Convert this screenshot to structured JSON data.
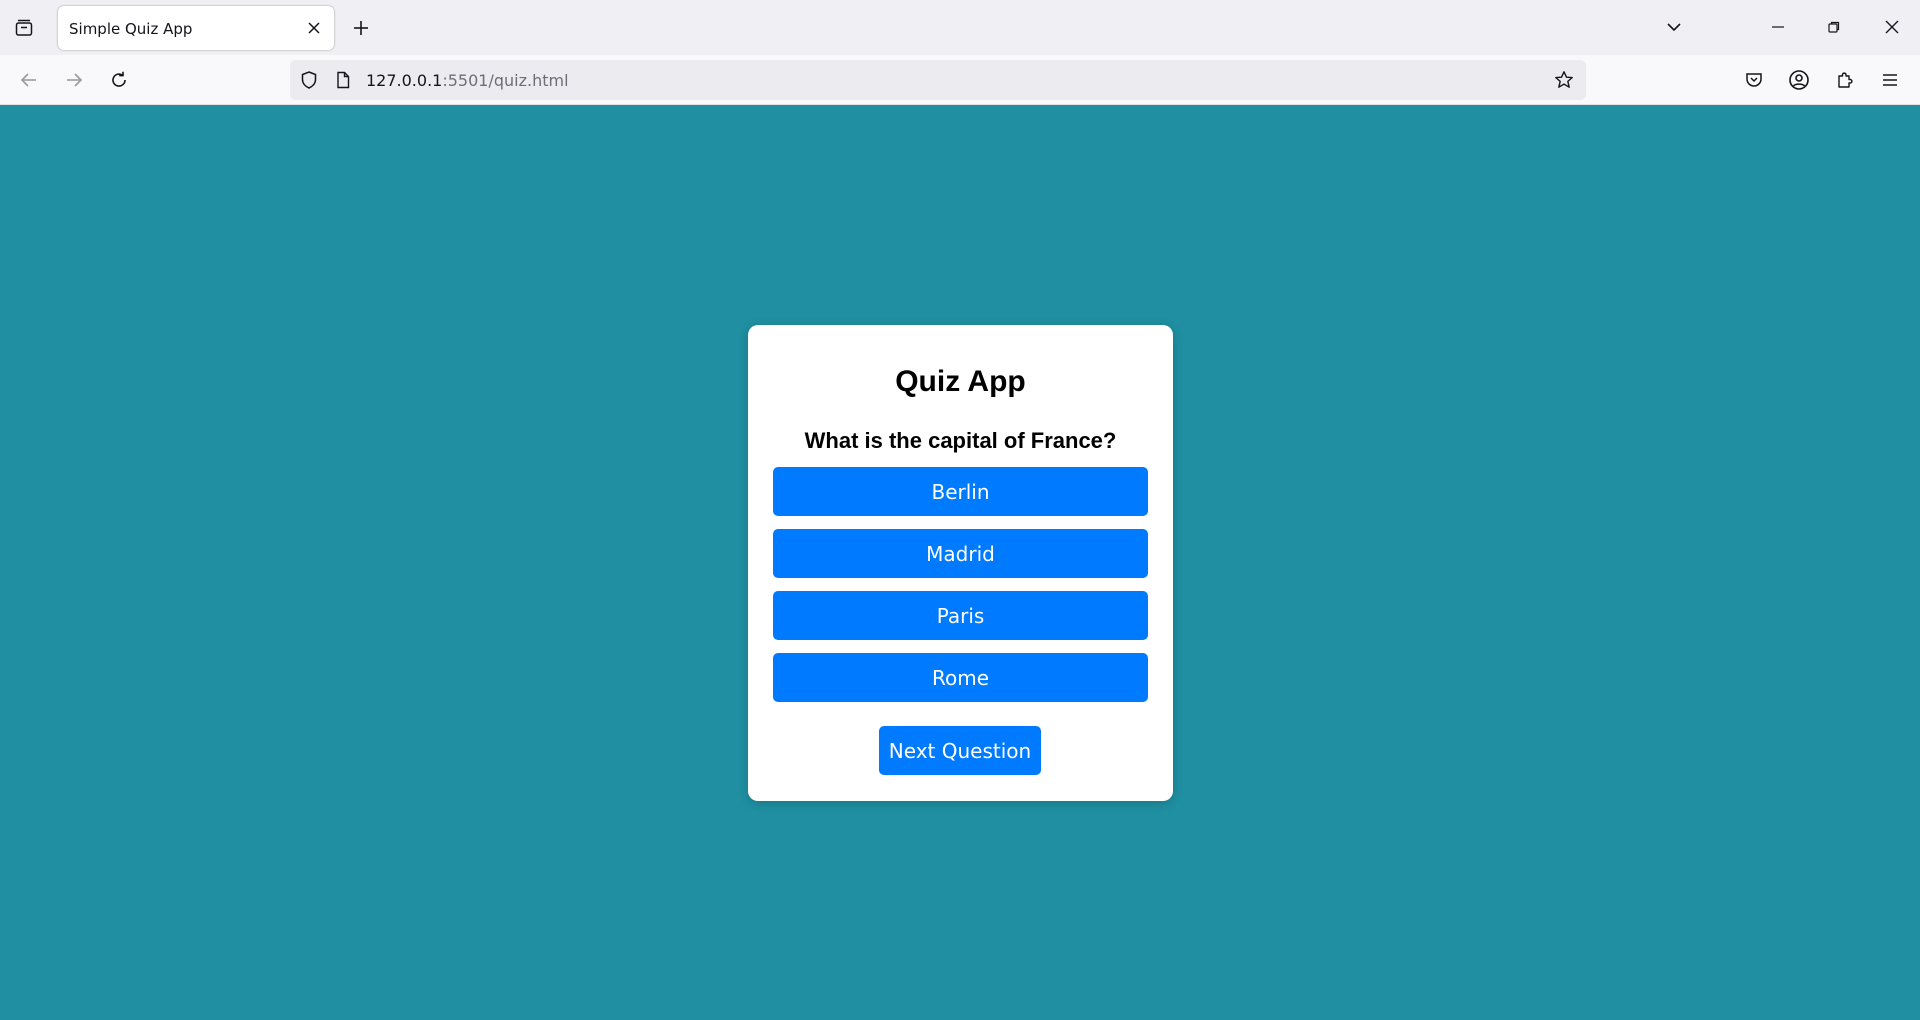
{
  "browser": {
    "tab": {
      "title": "Simple Quiz App"
    },
    "url": {
      "host": "127.0.0.1",
      "rest": ":5501/quiz.html"
    }
  },
  "quiz": {
    "title": "Quiz App",
    "question": "What is the capital of France?",
    "options": [
      "Berlin",
      "Madrid",
      "Paris",
      "Rome"
    ],
    "next_label": "Next Question"
  },
  "colors": {
    "page_background": "#1f8fa1",
    "button": "#007bff",
    "card": "#ffffff"
  },
  "icons": {
    "tab_list": "tab-list-icon",
    "close_tab": "close-icon",
    "new_tab": "plus-icon",
    "back": "back-arrow-icon",
    "forward": "forward-arrow-icon",
    "reload": "reload-icon",
    "shield": "shield-icon",
    "page": "page-icon",
    "bookmark": "star-icon",
    "pocket": "pocket-icon",
    "account": "account-icon",
    "extensions": "extensions-icon",
    "menu": "hamburger-menu-icon"
  }
}
